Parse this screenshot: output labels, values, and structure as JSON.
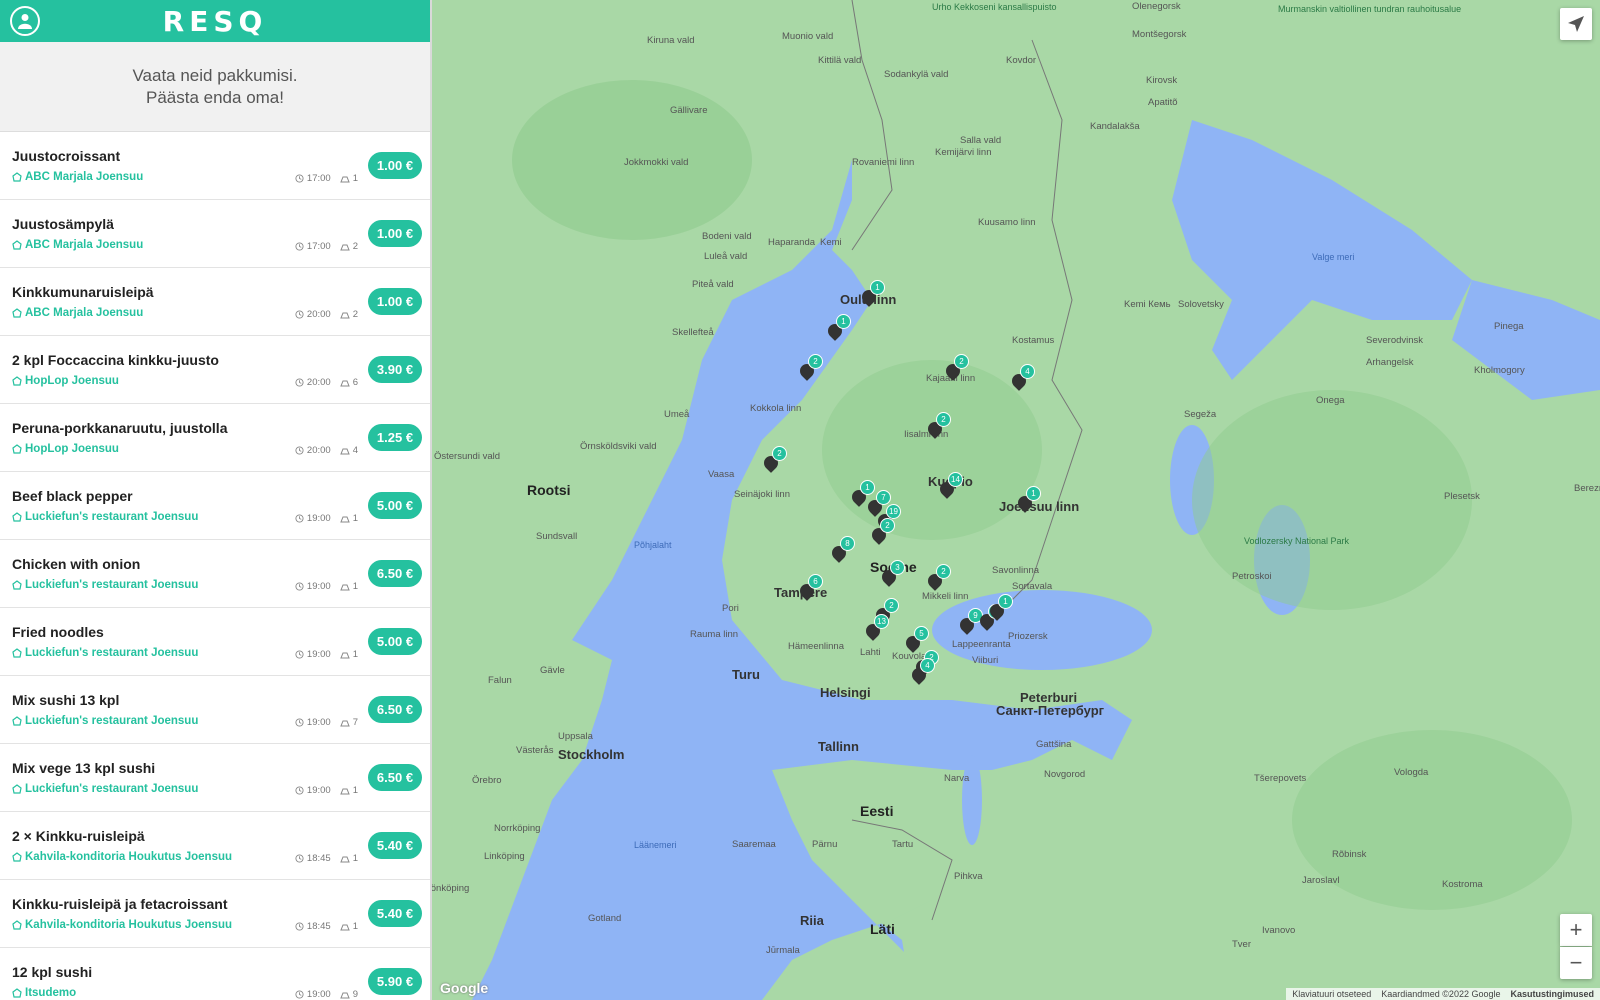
{
  "header": {
    "logo": "RESQ"
  },
  "banner": {
    "line1": "Vaata neid pakkumisi.",
    "line2": "Päästa enda oma!"
  },
  "offers": [
    {
      "title": "Juustocroissant",
      "store": "ABC Marjala Joensuu",
      "time": "17:00",
      "qty": "1",
      "price": "1.00 €"
    },
    {
      "title": "Juustosämpylä",
      "store": "ABC Marjala Joensuu",
      "time": "17:00",
      "qty": "2",
      "price": "1.00 €"
    },
    {
      "title": "Kinkkumunaruisleipä",
      "store": "ABC Marjala Joensuu",
      "time": "20:00",
      "qty": "2",
      "price": "1.00 €"
    },
    {
      "title": "2 kpl Foccaccina kinkku-juusto",
      "store": "HopLop Joensuu",
      "time": "20:00",
      "qty": "6",
      "price": "3.90 €"
    },
    {
      "title": "Peruna-porkkanaruutu, juustolla",
      "store": "HopLop Joensuu",
      "time": "20:00",
      "qty": "4",
      "price": "1.25 €"
    },
    {
      "title": "Beef black pepper",
      "store": "Luckiefun's restaurant Joensuu",
      "time": "19:00",
      "qty": "1",
      "price": "5.00 €"
    },
    {
      "title": "Chicken with onion",
      "store": "Luckiefun's restaurant Joensuu",
      "time": "19:00",
      "qty": "1",
      "price": "6.50 €"
    },
    {
      "title": "Fried noodles",
      "store": "Luckiefun's restaurant Joensuu",
      "time": "19:00",
      "qty": "1",
      "price": "5.00 €"
    },
    {
      "title": "Mix sushi 13 kpl",
      "store": "Luckiefun's restaurant Joensuu",
      "time": "19:00",
      "qty": "7",
      "price": "6.50 €"
    },
    {
      "title": "Mix vege 13 kpl sushi",
      "store": "Luckiefun's restaurant Joensuu",
      "time": "19:00",
      "qty": "1",
      "price": "6.50 €"
    },
    {
      "title": "2 × Kinkku-ruisleipä",
      "store": "Kahvila-konditoria Houkutus Joensuu",
      "time": "18:45",
      "qty": "1",
      "price": "5.40 €"
    },
    {
      "title": "Kinkku-ruisleipä ja fetacroissant",
      "store": "Kahvila-konditoria Houkutus Joensuu",
      "time": "18:45",
      "qty": "1",
      "price": "5.40 €"
    },
    {
      "title": "12 kpl sushi",
      "store": "Itsudemo",
      "time": "19:00",
      "qty": "9",
      "price": "5.90 €"
    }
  ],
  "map": {
    "countries": [
      "Rootsi",
      "Soome",
      "Eesti",
      "Läti"
    ],
    "major_cities": [
      "Helsingi",
      "Tallinn",
      "Stockholm",
      "Turu",
      "Tampere",
      "Oulu linn",
      "Joensuu linn",
      "Kuopio",
      "Peterburi",
      "Санкт-Петербург",
      "Riia"
    ],
    "cities": [
      "Kiruna vald",
      "Muonio vald",
      "Kittilä vald",
      "Sodankylä vald",
      "Gällivare",
      "Jokkmokki vald",
      "Rovaniemi linn",
      "Kemijärvi linn",
      "Salla vald",
      "Bodeni vald",
      "Haparanda",
      "Kemi",
      "Luleå vald",
      "Piteå vald",
      "Skellefteå",
      "Kuusamo linn",
      "Kajaani linn",
      "Iisalmi linn",
      "Umeå",
      "Kokkola linn",
      "Vaasa",
      "Seinäjoki linn",
      "Östersundi vald",
      "Örnsköldsviki vald",
      "Sundsvall",
      "Pori",
      "Rauma linn",
      "Hämeenlinna",
      "Lahti",
      "Kouvola",
      "Lappeenranta",
      "Mikkeli linn",
      "Savonlinna",
      "Viiburi",
      "Falun",
      "Gävle",
      "Uppsala",
      "Västerås",
      "Örebro",
      "Norrköping",
      "Linköping",
      "Jönköping",
      "Gotland",
      "Saaremaa",
      "Pärnu",
      "Tartu",
      "Pihkva",
      "Narva",
      "Jūrmala",
      "Olenegorsk",
      "Montšegorsk",
      "Kirovsk",
      "Apatitõ",
      "Kandalakša",
      "Kovdor",
      "Kostamus",
      "Kemi Кемь",
      "Solovetsky",
      "Segeža",
      "Severodvinsk",
      "Arhangelsk",
      "Onega",
      "Pinega",
      "Kholmogory",
      "Plesetsk",
      "Petroskoi",
      "Sortavala",
      "Priozersk",
      "Gattšina",
      "Novgorod",
      "Tšerepovets",
      "Vologda",
      "Rõbinsk",
      "Jaroslavl",
      "Kostroma",
      "Ivanovo",
      "Tver",
      "Bereznik"
    ],
    "water": [
      "Valge meri",
      "Põhjalaht",
      "Läänemeri"
    ],
    "parks": [
      "Urho Kekkoseni kansallispuisto",
      "Murmanskin valtiollinen tundran rauhoitusalue",
      "Vodlozersky National Park"
    ],
    "pin_counts": [
      "1",
      "1",
      "2",
      "2",
      "4",
      "2",
      "2",
      "1",
      "7",
      "19",
      "2",
      "8",
      "14",
      "1",
      "6",
      "2",
      "9",
      "2",
      "13",
      "5",
      "2",
      "4",
      "9",
      "1",
      "3"
    ],
    "attribution": {
      "google": "Google",
      "shortcuts": "Klaviatuuri otseteed",
      "mapdata": "Kaardiandmed ©2022 Google",
      "terms": "Kasutustingimused"
    },
    "zoom_in": "+",
    "zoom_out": "−",
    "colors": {
      "land": "#a9d8a6",
      "forest": "#8fcb8d",
      "water": "#8fb4f5",
      "accent": "#25c19f"
    }
  }
}
